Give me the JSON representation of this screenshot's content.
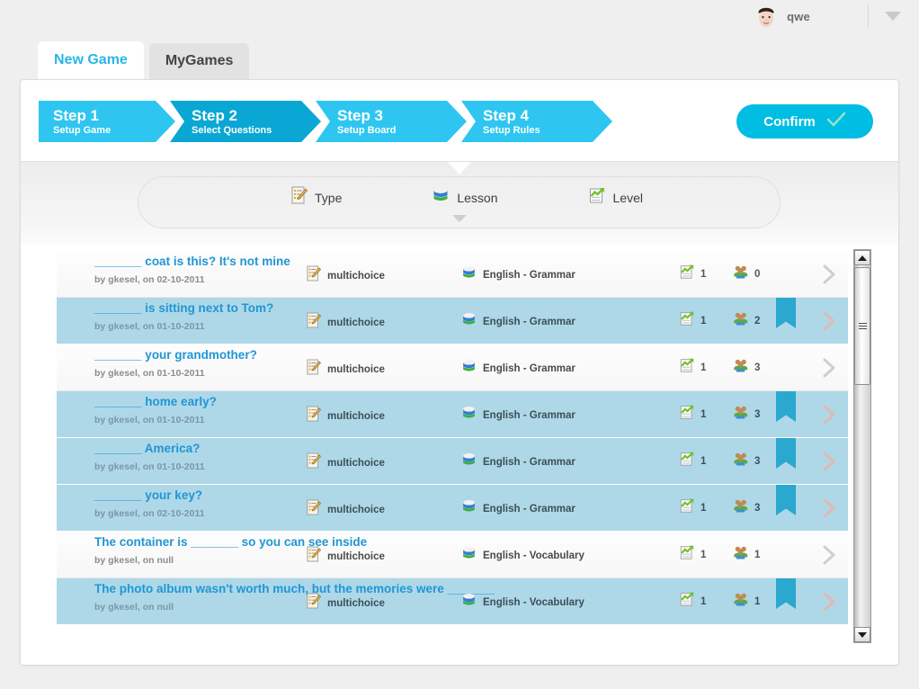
{
  "header": {
    "user_name": "qwe",
    "avatar_icon": "user-face-avatar",
    "dropdown_icon": "chevron-down-icon"
  },
  "tabs": [
    {
      "label": "New Game",
      "active": true
    },
    {
      "label": "MyGames",
      "active": false
    }
  ],
  "wizard": {
    "steps": [
      {
        "title": "Step 1",
        "subtitle": "Setup Game",
        "active": false
      },
      {
        "title": "Step 2",
        "subtitle": "Select Questions",
        "active": true
      },
      {
        "title": "Step 3",
        "subtitle": "Setup Board",
        "active": false
      },
      {
        "title": "Step 4",
        "subtitle": "Setup Rules",
        "active": false
      }
    ],
    "confirm_label": "Confirm",
    "confirm_icon": "check-icon",
    "colors": {
      "step": "#2ec6f0",
      "step_active": "#0aa7d4",
      "confirm": "#00bde3",
      "accent": "#2196d4",
      "row_selected": "#aed8e8",
      "bookmark": "#2aa8cf"
    }
  },
  "filters": [
    {
      "label": "Type",
      "icon": "type-form-icon"
    },
    {
      "label": "Lesson",
      "icon": "books-stack-icon"
    },
    {
      "label": "Level",
      "icon": "level-chart-icon"
    }
  ],
  "filter_expand_icon": "chevron-down-icon",
  "questions": [
    {
      "title": "_______ coat is this? It's not mine",
      "meta": "by gkesel, on 02-10-2011",
      "type": "multichoice",
      "lesson": "English - Grammar",
      "level": "1",
      "users": "0",
      "selected": false,
      "bookmarked": false
    },
    {
      "title": "_______ is sitting next to Tom?",
      "meta": "by gkesel, on 01-10-2011",
      "type": "multichoice",
      "lesson": "English - Grammar",
      "level": "1",
      "users": "2",
      "selected": true,
      "bookmarked": true
    },
    {
      "title": "_______ your grandmother?",
      "meta": "by gkesel, on 01-10-2011",
      "type": "multichoice",
      "lesson": "English - Grammar",
      "level": "1",
      "users": "3",
      "selected": false,
      "bookmarked": false
    },
    {
      "title": "_______ home early?",
      "meta": "by gkesel, on 01-10-2011",
      "type": "multichoice",
      "lesson": "English - Grammar",
      "level": "1",
      "users": "3",
      "selected": true,
      "bookmarked": true
    },
    {
      "title": "_______ America?",
      "meta": "by gkesel, on 01-10-2011",
      "type": "multichoice",
      "lesson": "English - Grammar",
      "level": "1",
      "users": "3",
      "selected": true,
      "bookmarked": true
    },
    {
      "title": "_______ your key?",
      "meta": "by gkesel, on 02-10-2011",
      "type": "multichoice",
      "lesson": "English - Grammar",
      "level": "1",
      "users": "3",
      "selected": true,
      "bookmarked": true
    },
    {
      "title": "The container is _______ so you can see inside",
      "meta": "by gkesel, on null",
      "type": "multichoice",
      "lesson": "English - Vocabulary",
      "level": "1",
      "users": "1",
      "selected": false,
      "bookmarked": false
    },
    {
      "title": "The photo album wasn't worth much, but the memories were _______",
      "meta": "by gkesel, on null",
      "type": "multichoice",
      "lesson": "English - Vocabulary",
      "level": "1",
      "users": "1",
      "selected": true,
      "bookmarked": true
    }
  ],
  "scrollbar": {
    "up_icon": "scroll-up-arrow-icon",
    "down_icon": "scroll-down-arrow-icon",
    "thumb_icon": "scroll-thumb-grip"
  }
}
